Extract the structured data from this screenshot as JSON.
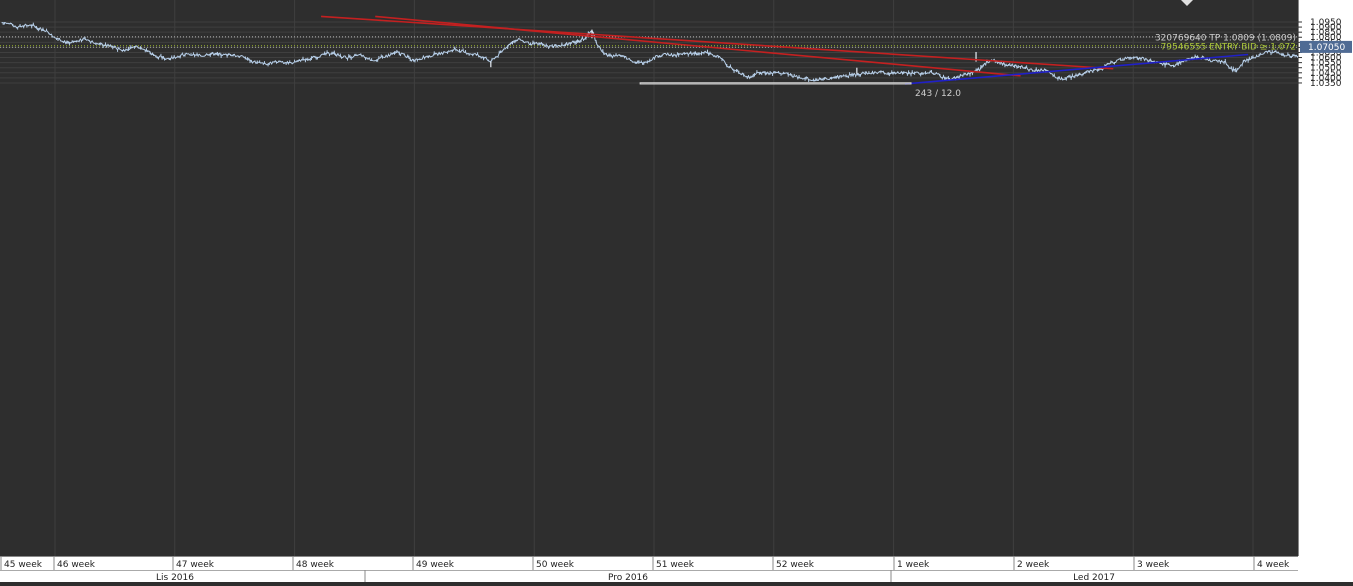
{
  "chart_data": {
    "type": "line",
    "instrument_style": "price bars",
    "title": "",
    "xlabel": "",
    "ylabel": "",
    "ylim": [
      1.0325,
      1.0985
    ],
    "y_ticks": [
      "1.0950",
      "1.0900",
      "1.0850",
      "1.0800",
      "1.0750",
      "1.0700",
      "1.0650",
      "1.0600",
      "1.0550",
      "1.0500",
      "1.0450",
      "1.0400",
      "1.0350"
    ],
    "x_axis": {
      "weeks": [
        "45 week",
        "46 week",
        "47 week",
        "48 week",
        "49 week",
        "50 week",
        "51 week",
        "52 week",
        "1 week",
        "2 week",
        "3 week",
        "4 week"
      ],
      "months": [
        "Lis 2016",
        "Pro 2016",
        "Led 2017"
      ]
    },
    "price_series": {
      "name": "",
      "unit": "week index",
      "points": [
        [
          0.0,
          1.0945
        ],
        [
          0.06,
          1.093
        ],
        [
          0.12,
          1.0905
        ],
        [
          0.18,
          1.0915
        ],
        [
          0.26,
          1.0915
        ],
        [
          0.31,
          1.0885
        ],
        [
          0.37,
          1.0865
        ],
        [
          0.43,
          1.08
        ],
        [
          0.5,
          1.077
        ],
        [
          0.56,
          1.0735
        ],
        [
          0.63,
          1.076
        ],
        [
          0.69,
          1.079
        ],
        [
          0.76,
          1.0745
        ],
        [
          0.82,
          1.073
        ],
        [
          0.88,
          1.0715
        ],
        [
          0.94,
          1.07
        ],
        [
          1.0,
          1.067
        ],
        [
          1.06,
          1.069
        ],
        [
          1.12,
          1.071
        ],
        [
          1.18,
          1.069
        ],
        [
          1.24,
          1.064
        ],
        [
          1.3,
          1.061
        ],
        [
          1.36,
          1.059
        ],
        [
          1.42,
          1.06
        ],
        [
          1.48,
          1.062
        ],
        [
          1.54,
          1.063
        ],
        [
          1.6,
          1.0625
        ],
        [
          1.66,
          1.0615
        ],
        [
          1.72,
          1.064
        ],
        [
          1.78,
          1.0635
        ],
        [
          1.84,
          1.0625
        ],
        [
          1.9,
          1.063
        ],
        [
          1.96,
          1.0615
        ],
        [
          2.02,
          1.06
        ],
        [
          2.08,
          1.056
        ],
        [
          2.14,
          1.0545
        ],
        [
          2.2,
          1.053
        ],
        [
          2.26,
          1.0555
        ],
        [
          2.32,
          1.056
        ],
        [
          2.38,
          1.0545
        ],
        [
          2.44,
          1.056
        ],
        [
          2.5,
          1.058
        ],
        [
          2.56,
          1.059
        ],
        [
          2.62,
          1.061
        ],
        [
          2.68,
          1.063
        ],
        [
          2.74,
          1.065
        ],
        [
          2.8,
          1.062
        ],
        [
          2.86,
          1.06
        ],
        [
          2.92,
          1.061
        ],
        [
          2.98,
          1.062
        ],
        [
          3.04,
          1.059
        ],
        [
          3.1,
          1.0575
        ],
        [
          3.16,
          1.06
        ],
        [
          3.22,
          1.0625
        ],
        [
          3.28,
          1.065
        ],
        [
          3.34,
          1.063
        ],
        [
          3.4,
          1.0575
        ],
        [
          3.46,
          1.059
        ],
        [
          3.52,
          1.0605
        ],
        [
          3.58,
          1.0625
        ],
        [
          3.64,
          1.064
        ],
        [
          3.7,
          1.0655
        ],
        [
          3.76,
          1.0685
        ],
        [
          3.82,
          1.066
        ],
        [
          3.88,
          1.064
        ],
        [
          3.94,
          1.063
        ],
        [
          4.0,
          1.06
        ],
        [
          4.06,
          1.056
        ],
        [
          4.12,
          1.062
        ],
        [
          4.18,
          1.0695
        ],
        [
          4.24,
          1.076
        ],
        [
          4.3,
          1.0775
        ],
        [
          4.36,
          1.0745
        ],
        [
          4.42,
          1.0735
        ],
        [
          4.48,
          1.073
        ],
        [
          4.54,
          1.0705
        ],
        [
          4.6,
          1.0715
        ],
        [
          4.66,
          1.072
        ],
        [
          4.72,
          1.074
        ],
        [
          4.78,
          1.076
        ],
        [
          4.84,
          1.079
        ],
        [
          4.9,
          1.087
        ],
        [
          4.94,
          1.074
        ],
        [
          5.0,
          1.064
        ],
        [
          5.06,
          1.061
        ],
        [
          5.12,
          1.0625
        ],
        [
          5.18,
          1.06
        ],
        [
          5.24,
          1.056
        ],
        [
          5.3,
          1.0545
        ],
        [
          5.36,
          1.0565
        ],
        [
          5.42,
          1.06
        ],
        [
          5.48,
          1.0625
        ],
        [
          5.54,
          1.063
        ],
        [
          5.6,
          1.062
        ],
        [
          5.66,
          1.064
        ],
        [
          5.72,
          1.064
        ],
        [
          5.78,
          1.063
        ],
        [
          5.84,
          1.0655
        ],
        [
          5.9,
          1.063
        ],
        [
          5.96,
          1.06
        ],
        [
          6.02,
          1.053
        ],
        [
          6.08,
          1.048
        ],
        [
          6.14,
          1.0445
        ],
        [
          6.2,
          1.0405
        ],
        [
          6.26,
          1.044
        ],
        [
          6.32,
          1.0455
        ],
        [
          6.38,
          1.0445
        ],
        [
          6.44,
          1.0455
        ],
        [
          6.5,
          1.0445
        ],
        [
          6.56,
          1.042
        ],
        [
          6.62,
          1.0405
        ],
        [
          6.68,
          1.0395
        ],
        [
          6.74,
          1.037
        ],
        [
          6.8,
          1.0385
        ],
        [
          6.86,
          1.0395
        ],
        [
          6.92,
          1.0405
        ],
        [
          6.98,
          1.0415
        ],
        [
          7.04,
          1.0425
        ],
        [
          7.1,
          1.044
        ],
        [
          7.16,
          1.0445
        ],
        [
          7.22,
          1.045
        ],
        [
          7.28,
          1.0455
        ],
        [
          7.34,
          1.0445
        ],
        [
          7.4,
          1.045
        ],
        [
          7.46,
          1.0455
        ],
        [
          7.52,
          1.045
        ],
        [
          7.58,
          1.0445
        ],
        [
          7.64,
          1.045
        ],
        [
          7.7,
          1.0455
        ],
        [
          7.76,
          1.044
        ],
        [
          7.82,
          1.0405
        ],
        [
          7.88,
          1.039
        ],
        [
          7.94,
          1.041
        ],
        [
          8.0,
          1.0435
        ],
        [
          8.06,
          1.045
        ],
        [
          8.12,
          1.048
        ],
        [
          8.18,
          1.056
        ],
        [
          8.24,
          1.0575
        ],
        [
          8.3,
          1.054
        ],
        [
          8.36,
          1.053
        ],
        [
          8.42,
          1.052
        ],
        [
          8.48,
          1.0505
        ],
        [
          8.54,
          1.048
        ],
        [
          8.6,
          1.0475
        ],
        [
          8.66,
          1.048
        ],
        [
          8.72,
          1.043
        ],
        [
          8.78,
          1.0395
        ],
        [
          8.84,
          1.04
        ],
        [
          8.9,
          1.041
        ],
        [
          8.96,
          1.044
        ],
        [
          9.02,
          1.0465
        ],
        [
          9.08,
          1.0475
        ],
        [
          9.14,
          1.049
        ],
        [
          9.2,
          1.054
        ],
        [
          9.26,
          1.057
        ],
        [
          9.32,
          1.0585
        ],
        [
          9.38,
          1.061
        ],
        [
          9.44,
          1.06
        ],
        [
          9.5,
          1.058
        ],
        [
          9.56,
          1.0555
        ],
        [
          9.62,
          1.0545
        ],
        [
          9.68,
          1.053
        ],
        [
          9.74,
          1.052
        ],
        [
          9.8,
          1.0565
        ],
        [
          9.86,
          1.0585
        ],
        [
          9.92,
          1.061
        ],
        [
          9.98,
          1.0595
        ],
        [
          10.04,
          1.057
        ],
        [
          10.1,
          1.0565
        ],
        [
          10.16,
          1.0555
        ],
        [
          10.22,
          1.048
        ],
        [
          10.26,
          1.047
        ],
        [
          10.32,
          1.0565
        ],
        [
          10.38,
          1.0595
        ],
        [
          10.44,
          1.062
        ],
        [
          10.5,
          1.065
        ],
        [
          10.56,
          1.0655
        ],
        [
          10.62,
          1.0635
        ],
        [
          10.68,
          1.0615
        ],
        [
          10.74,
          1.061
        ],
        [
          10.8,
          1.0625
        ],
        [
          10.86,
          1.065
        ],
        [
          10.92,
          1.064
        ],
        [
          10.98,
          1.062
        ],
        [
          11.04,
          1.0595
        ],
        [
          11.1,
          1.06
        ],
        [
          11.16,
          1.061
        ],
        [
          11.22,
          1.062
        ],
        [
          11.28,
          1.066
        ],
        [
          11.34,
          1.069
        ],
        [
          11.4,
          1.071
        ]
      ]
    },
    "trend_lines": [
      {
        "name": "red-channel-upper",
        "color": "#c42020",
        "from": [
          2.65,
          1.1005
        ],
        "to": [
          9.23,
          1.049
        ]
      },
      {
        "name": "red-channel-lower",
        "color": "#c42020",
        "from": [
          3.1,
          1.1005
        ],
        "to": [
          8.46,
          1.042
        ]
      },
      {
        "name": "blue-support",
        "color": "#2020c8",
        "from": [
          7.5,
          1.034
        ],
        "to": [
          10.35,
          1.063
        ]
      }
    ],
    "range_box": {
      "x_from": 5.3,
      "x_to": 7.55,
      "y_from": 1.034,
      "y_to": 1.0352,
      "label": "243 / 12.0",
      "color": "#d8d8d8"
    },
    "levels": [
      {
        "name": "tp-level",
        "value": 1.0809,
        "label": "320769640  TP 1.0809 (1.0809)",
        "color": "#bdbdbd",
        "label_color": "#cfcfcf"
      },
      {
        "name": "entry-level",
        "value": 1.0721,
        "label": "79546555  ENTRY BID ≥ 1.072",
        "color": "#9bb82a",
        "label_color": "#a9c43c"
      },
      {
        "name": "current-price",
        "value": 1.0705,
        "label": "1.07050",
        "color": "#9a9a9a",
        "label_color": "#ffffff",
        "badge_color": "#4f6b94"
      }
    ],
    "colors": {
      "background": "#2e2e2e",
      "axis_panel": "#ffffff",
      "grid": "#3f3f3f",
      "price": "#b7cfe9"
    }
  }
}
